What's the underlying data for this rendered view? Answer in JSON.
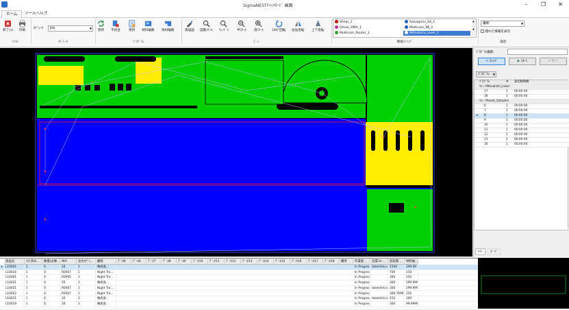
{
  "window": {
    "title": "SigmaNESTｸｲｯｸﾓｰﾄﾞ 画面"
  },
  "tabs": [
    "ホーム",
    "ツールヘルプ"
  ],
  "ribbon": {
    "groups": {
      "file": "ﾌｧｲﾙ",
      "operator": "ｵﾍﾟﾚｰﾀ",
      "program": "ﾌﾟﾛｸﾞﾗﾑ",
      "view": "ﾋﾞｭｰ",
      "machine": "機械ｺﾝﾌｨｸﾞ",
      "history": "履歴"
    },
    "file": {
      "exit": "終了(x)",
      "print": "印刷"
    },
    "operator": {
      "label": "ｵﾍﾟﾚｰﾀ",
      "value": "Joe"
    },
    "update": "更新",
    "mismatch": "不具合",
    "update2": "更新",
    "material_edit": "材料編集",
    "remnant_edit": "残材編集",
    "view": {
      "redraw": "再描画",
      "auto_scale": "自動ｽｹｰﾙ",
      "window": "ｳｨﾝﾄﾞｳ",
      "half_scale": "半ｽｹｰﾙ",
      "double_scale": "倍ｽｹｰﾙ",
      "rotate180": "180°回転",
      "flip_lr": "左右反転",
      "flip_ud": "上下反転"
    },
    "machines": [
      {
        "name": "Shear_1",
        "color": "#c00000"
      },
      {
        "name": "Salvagnini_S4_1",
        "color": "#2060c0"
      },
      {
        "name": "Omax_OMX_1",
        "color": "#c03090"
      },
      {
        "name": "Multicam_WJ_1",
        "color": "#2060c0"
      },
      {
        "name": "Multicam_Router_1",
        "color": "#30a030"
      },
      {
        "name": "Mitsubishi_Laser_1",
        "color": "#2060c0"
      }
    ],
    "history": {
      "combo": "最新",
      "checkbox": "隠れた情報を表示"
    }
  },
  "panel": {
    "search_label": "ﾌﾟﾛｸﾞﾗﾑ検索:",
    "btn_stop": "ｽﾄｯﾌﾟ",
    "btn_start": "ｽﾀｰﾄ",
    "btn_end": "終了",
    "view_combo": "ﾌﾟﾛｸﾞﾗﾑ",
    "columns": [
      "ﾌﾟﾛｸﾞﾗﾑ",
      "#",
      "実切削時間"
    ],
    "groups": [
      {
        "name": "ﾏｼﾝ: Mitsubishi_Laser",
        "rows": [
          [
            "17",
            "1",
            "00:00:00"
          ],
          [
            "18",
            "1",
            "00:00:00"
          ]
        ]
      },
      {
        "name": "ﾏｼﾝ: Mazak_Optiplex",
        "rows": [
          [
            "6",
            "1",
            "00:00:00"
          ],
          [
            "7",
            "1",
            "00:00:00"
          ],
          [
            "8",
            "1",
            "00:00:00"
          ],
          [
            "9",
            "1",
            "00:00:00"
          ],
          [
            "10",
            "1",
            "00:00:00"
          ],
          [
            "11",
            "1",
            "00:00:00"
          ],
          [
            "12",
            "1",
            "00:00:00"
          ],
          [
            "13",
            "1",
            "00:00:00"
          ],
          [
            "16",
            "1",
            "00:00:00"
          ]
        ]
      }
    ],
    "bottom_tabs": [
      "ﾘｽﾄ",
      "ﾎﾞｰﾄﾞ"
    ]
  },
  "grid": {
    "columns": [
      "部品名",
      "ﾈｽﾄ済み...",
      "数量(必要...",
      "WO",
      "注文ｵﾌﾟｼ...",
      "顧客",
      "ﾃﾞｰﾀ6",
      "ﾃﾞｰﾀ6",
      "ﾃﾞｰﾀ7",
      "ﾃﾞｰﾀ8",
      "ﾃﾞｰﾀ9",
      "ﾃﾞｰﾀ10",
      "ﾃﾞｰﾀ11",
      "ﾃﾞｰﾀ12",
      "ﾃﾞｰﾀ13",
      "ﾃﾞｰﾀ14",
      "ﾃﾞｰﾀ15",
      "ﾃﾞｰﾀ16",
      "ﾃﾞｰﾀ17",
      "ﾃﾞｰﾀ18",
      "備考",
      "作業進...",
      "営業ｽﾀｯ...",
      "前段階...",
      "材料幅..."
    ],
    "rows": [
      [
        "L10001",
        "2",
        "0",
        "16",
        "1",
        "株式会...",
        "In Progress",
        "takeshito.s...",
        "1500",
        "299.99"
      ],
      [
        "L10016",
        "1",
        "0",
        "R0007",
        "1",
        "Night Tra...",
        "In Progress",
        "",
        "700",
        "150"
      ],
      [
        "L10001",
        "1",
        "0",
        "R0005",
        "1",
        "Night Tra...",
        "In Progress",
        "",
        "300",
        "250"
      ],
      [
        "L10021",
        "1",
        "0",
        "20",
        "1",
        "株式会...",
        "In Progress",
        "",
        "300",
        "299.999"
      ],
      [
        "L10021",
        "1",
        "0",
        "R0007",
        "1",
        "Night Tra...",
        "In Progress",
        "takeshito.s...",
        "300",
        "299.999"
      ],
      [
        "L10022",
        "1",
        "0",
        "R0007",
        "1",
        "Night Tra...",
        "In Progress",
        "",
        "300.7699...",
        "250"
      ],
      [
        "L10021",
        "1",
        "0",
        "20",
        "1",
        "株式会...",
        "In Progress",
        "takeshito.s...",
        "250",
        "300"
      ],
      [
        "L10019",
        "1",
        "0",
        "16",
        "1",
        "株式会...",
        "In Progress",
        "",
        "300",
        "99.9999"
      ]
    ]
  },
  "colors": {
    "part_green": "#00d000",
    "part_yellow": "#ffee00",
    "remnant_blue": "#0000ff",
    "canvas": "#000000",
    "sheet_outline": "#ff3030"
  }
}
